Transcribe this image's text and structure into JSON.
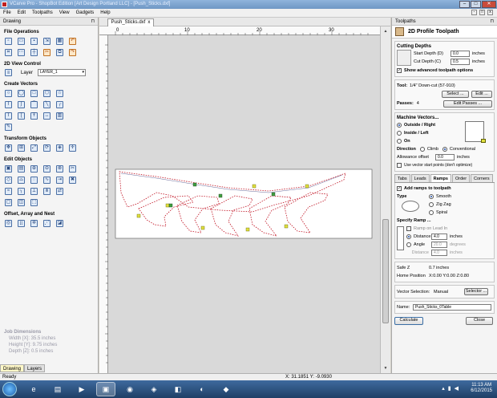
{
  "window": {
    "title": "VCarve Pro - ShopBot Edition [Art Design Portland LLC] - [Push_Sticks.dxf]"
  },
  "menu": [
    "File",
    "Edit",
    "Toolpaths",
    "View",
    "Gadgets",
    "Help"
  ],
  "left_panel": {
    "title": "Drawing",
    "sections": {
      "file_ops": "File Operations",
      "view_control": "2D View Control",
      "create_vectors": "Create Vectors",
      "transform": "Transform Objects",
      "edit": "Edit Objects",
      "offset": "Offset, Array and Nest"
    },
    "layer_label": "Layer",
    "layer_value": "LAYER_1",
    "job_dimensions": {
      "heading": "Job Dimensions",
      "width": "Width  [X]: 35.5 inches",
      "height": "Height [Y]: 9.75 inches",
      "depth": "Depth  [Z]: 0.5 inches"
    },
    "tabs": [
      "Drawing",
      "Layers"
    ]
  },
  "document": {
    "tab_label": "Push_Sticks.dxf",
    "ruler_ticks": [
      "0",
      "10",
      "20",
      "30"
    ]
  },
  "right_panel": {
    "header": "Toolpaths",
    "title": "2D Profile Toolpath",
    "cutting_depths": {
      "heading": "Cutting Depths",
      "start_label": "Start Depth (D)",
      "start_value": "0.0",
      "cut_label": "Cut Depth (C)",
      "cut_value": "0.5",
      "units": "inches",
      "advanced": "Show advanced toolpath options"
    },
    "tool": {
      "label": "Tool:",
      "value": "1/4\" Down-cut (57-910)",
      "select": "Select ...",
      "edit": "Edit ...",
      "passes_label": "Passes:",
      "passes_value": "4",
      "edit_passes": "Edit Passes ..."
    },
    "machine_vectors": {
      "heading": "Machine Vectors...",
      "outside": "Outside / Right",
      "inside": "Inside / Left",
      "on": "On",
      "direction": "Direction",
      "climb": "Climb",
      "conventional": "Conventional",
      "allowance_label": "Allowance offset",
      "allowance_value": "0.0",
      "allowance_units": "inches",
      "vector_start": "Use vector start points (don't optimize)"
    },
    "tabs": [
      "Tabs",
      "Leads",
      "Ramps",
      "Order",
      "Corners"
    ],
    "ramps": {
      "add": "Add ramps to toolpath",
      "type_label": "Type",
      "smooth": "Smooth",
      "zigzag": "Zig Zag",
      "spiral": "Spiral",
      "specify": "Specify Ramp ...",
      "on_lead": "Ramp on Lead In",
      "distance": "Distance",
      "distance_value": "4.0",
      "distance_units": "inches",
      "angle": "Angle",
      "angle_value": "20.0",
      "angle_units": "degrees",
      "dist2_label": "Distance",
      "dist2_value": "4.0",
      "dist2_units": "inches"
    },
    "safe_z": "Safe Z",
    "safe_z_value": "0.7 inches",
    "home_label": "Home Position",
    "home_value": "X:0.00 Y:0.00 Z:0.80",
    "vector_selection_label": "Vector Selection:",
    "vector_selection_value": "Manual",
    "selector_btn": "Selector ...",
    "name_label": "Name:",
    "name_value": "Push_Sticks_0Table",
    "calculate": "Calculate",
    "close": "Close"
  },
  "status": {
    "ready": "Ready",
    "coords": "X: 31.1851 Y: -9.0930"
  },
  "taskbar": {
    "time": "11:13 AM",
    "date": "6/12/2015"
  },
  "colors": {
    "accent": "#3a6ea5",
    "toolpath": "#c01020",
    "vector": "#6a6a9a"
  }
}
